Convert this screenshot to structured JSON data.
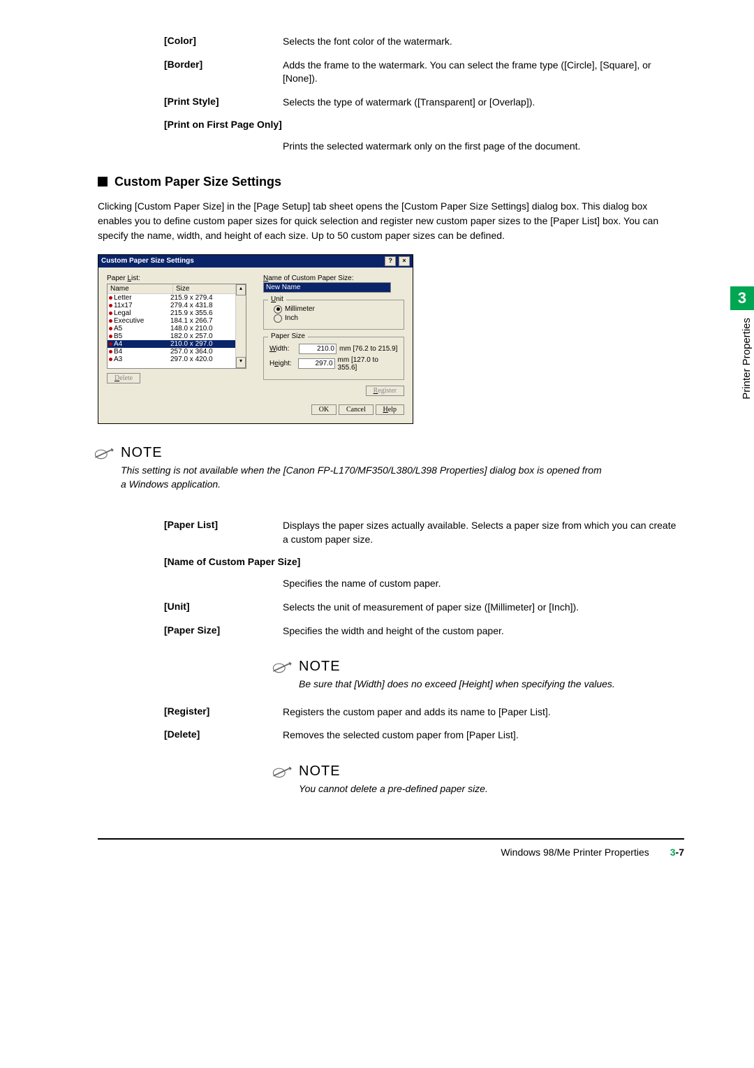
{
  "top_defs": {
    "color_label": "[Color]",
    "color_desc": "Selects the font color of the watermark.",
    "border_label": "[Border]",
    "border_desc": "Adds the frame to the watermark. You can select the frame type ([Circle], [Square], or [None]).",
    "printstyle_label": "[Print Style]",
    "printstyle_desc": "Selects the type of watermark ([Transparent] or [Overlap]).",
    "firstpage_label": "[Print on First Page Only]",
    "firstpage_desc": "Prints the selected watermark only on the first page of the document."
  },
  "section_title": "Custom Paper Size Settings",
  "intro": "Clicking [Custom Paper Size] in the [Page Setup] tab sheet opens the [Custom Paper Size Settings] dialog box. This dialog box enables you to define custom paper sizes for quick selection and register new custom paper sizes to the [Paper List] box. You can specify the name, width, and height of each size. Up to 50 custom paper sizes can be defined.",
  "dialog": {
    "title": "Custom Paper Size Settings",
    "paper_list_label": "Paper List:",
    "col_name": "Name",
    "col_size": "Size",
    "rows": [
      {
        "name": "Letter",
        "size": "215.9 x 279.4"
      },
      {
        "name": "11x17",
        "size": "279.4 x 431.8"
      },
      {
        "name": "Legal",
        "size": "215.9 x 355.6"
      },
      {
        "name": "Executive",
        "size": "184.1 x 266.7"
      },
      {
        "name": "A5",
        "size": "148.0 x 210.0"
      },
      {
        "name": "B5",
        "size": "182.0 x 257.0"
      },
      {
        "name": "A4",
        "size": "210.0 x 297.0",
        "selected": true
      },
      {
        "name": "B4",
        "size": "257.0 x 364.0"
      },
      {
        "name": "A3",
        "size": "297.0 x 420.0"
      }
    ],
    "delete_label": "Delete",
    "name_label": "Name of Custom Paper Size:",
    "name_value": "New Name",
    "unit_label": "Unit",
    "unit_mm": "Millimeter",
    "unit_in": "Inch",
    "papersize_label": "Paper Size",
    "width_label": "Width:",
    "width_value": "210.0",
    "width_hint": "mm [76.2 to 215.9]",
    "height_label": "Height:",
    "height_value": "297.0",
    "height_hint": "mm [127.0 to 355.6]",
    "register_label": "Register",
    "ok": "OK",
    "cancel": "Cancel",
    "help": "Help"
  },
  "note_main": {
    "title": "NOTE",
    "text": "This setting is not available when the [Canon FP-L170/MF350/L380/L398 Properties] dialog box is opened from a Windows application."
  },
  "defs2": {
    "paperlist_label": "[Paper List]",
    "paperlist_desc": "Displays the paper sizes actually available. Selects a paper size from which you can create a custom paper size.",
    "namecustom_label": "[Name of Custom Paper Size]",
    "namecustom_desc": "Specifies the name of custom paper.",
    "unit_label": "[Unit]",
    "unit_desc": "Selects the unit of measurement of paper size ([Millimeter] or [Inch]).",
    "papersize_label": "[Paper Size]",
    "papersize_desc": "Specifies the width and height of the custom paper."
  },
  "note_indent1": {
    "title": "NOTE",
    "text": "Be sure that [Width] does no exceed [Height] when specifying the values."
  },
  "defs3": {
    "register_label": "[Register]",
    "register_desc": "Registers the custom paper and adds its name to [Paper List].",
    "delete_label": "[Delete]",
    "delete_desc": "Removes the selected custom paper from [Paper List]."
  },
  "note_indent2": {
    "title": "NOTE",
    "text": "You cannot delete a pre-defined paper size."
  },
  "side": {
    "num": "3",
    "label": "Printer Properties"
  },
  "footer": {
    "text": "Windows 98/Me Printer Properties",
    "page": "3-7"
  }
}
